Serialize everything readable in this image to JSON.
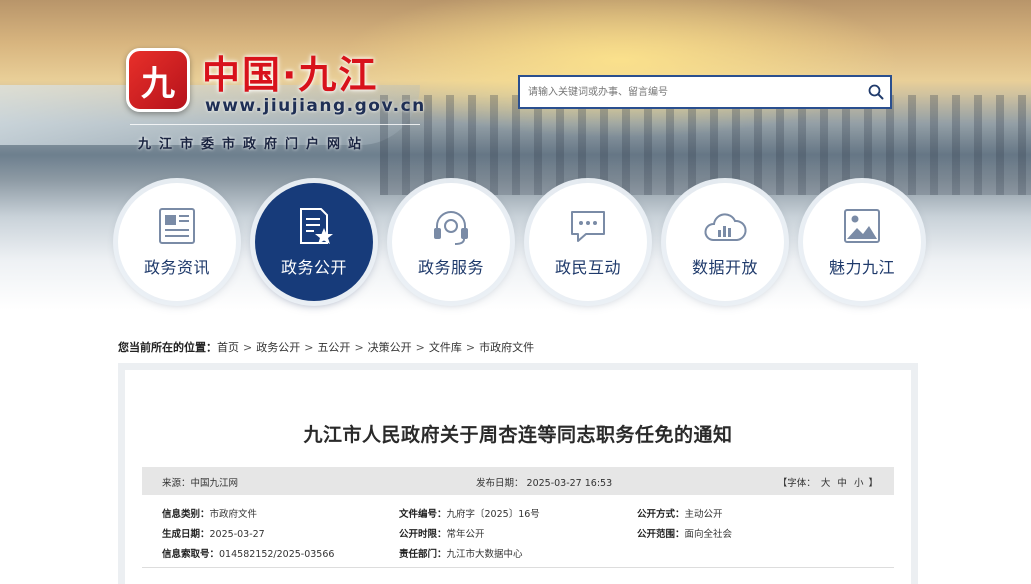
{
  "site": {
    "logo_glyph": "九",
    "title": "中国·九江",
    "url": "www.jiujiang.gov.cn",
    "subtitle": "九江市委市政府门户网站"
  },
  "search": {
    "placeholder": "请输入关键词或办事、留言编号"
  },
  "nav": {
    "items": [
      {
        "label": "政务资讯",
        "icon": "newspaper-icon",
        "active": false
      },
      {
        "label": "政务公开",
        "icon": "document-star-icon",
        "active": true
      },
      {
        "label": "政务服务",
        "icon": "headset-icon",
        "active": false
      },
      {
        "label": "政民互动",
        "icon": "chat-bubble-icon",
        "active": false
      },
      {
        "label": "数据开放",
        "icon": "cloud-chart-icon",
        "active": false
      },
      {
        "label": "魅力九江",
        "icon": "image-icon",
        "active": false
      }
    ]
  },
  "breadcrumb": {
    "prefix": "您当前所在的位置：",
    "items": [
      "首页",
      "政务公开",
      "五公开",
      "决策公开",
      "文件库",
      "市政府文件"
    ],
    "separator": ">"
  },
  "article": {
    "title": "九江市人民政府关于周杏连等同志职务任免的通知",
    "meta": {
      "source": "来源：中国九江网",
      "date": "发布日期：  2025-03-27 16:53",
      "font_prefix": "【字体：",
      "font_large": "大",
      "font_medium": "中",
      "font_small": "小",
      "font_suffix": "】"
    },
    "info": {
      "row1": {
        "category_k": "信息类别：",
        "category_v": "市政府文件",
        "docno_k": "文件编号：",
        "docno_v": "九府字〔2025〕16号",
        "method_k": "公开方式：",
        "method_v": "主动公开"
      },
      "row2": {
        "created_k": "生成日期：",
        "created_v": "2025-03-27",
        "period_k": "公开时限：",
        "period_v": "常年公开",
        "scope_k": "公开范围：",
        "scope_v": "面向全社会"
      },
      "row3": {
        "index_k": "信息索取号：",
        "index_v": "014582152/2025-03566",
        "dept_k": "责任部门：",
        "dept_v": "九江市大数据中心"
      }
    }
  },
  "colors": {
    "brand_red": "#d8121b",
    "nav_active": "#173b7a",
    "nav_text": "#1f3a6b",
    "meta_bg": "#e6e6e6"
  }
}
